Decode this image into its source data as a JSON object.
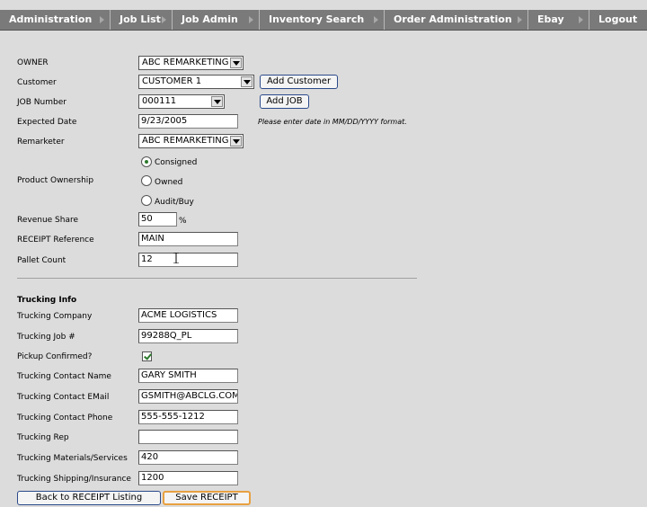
{
  "nav": {
    "items": [
      {
        "label": "Administration"
      },
      {
        "label": "Job List"
      },
      {
        "label": "Job Admin"
      },
      {
        "label": "Inventory Search"
      },
      {
        "label": "Order Administration"
      },
      {
        "label": "Ebay"
      },
      {
        "label": "Logout"
      }
    ]
  },
  "form": {
    "owner": {
      "label": "OWNER",
      "value": "ABC REMARKETING"
    },
    "customer": {
      "label": "Customer",
      "value": "CUSTOMER 1",
      "add_button": "Add Customer"
    },
    "job_number": {
      "label": "JOB Number",
      "value": "000111",
      "add_button": "Add JOB"
    },
    "expected_date": {
      "label": "Expected Date",
      "value": "9/23/2005",
      "hint": "Please enter date in MM/DD/YYYY format."
    },
    "remarketer": {
      "label": "Remarketer",
      "value": "ABC REMARKETING"
    },
    "product_ownership": {
      "label": "Product Ownership",
      "options": [
        "Consigned",
        "Owned",
        "Audit/Buy"
      ],
      "selected": "Consigned"
    },
    "revenue_share": {
      "label": "Revenue Share",
      "value": "50",
      "unit": "%"
    },
    "receipt_reference": {
      "label": "RECEIPT Reference",
      "value": "MAIN"
    },
    "pallet_count": {
      "label": "Pallet Count",
      "value": "12"
    }
  },
  "trucking": {
    "heading": "Trucking Info",
    "company": {
      "label": "Trucking Company",
      "value": "ACME LOGISTICS"
    },
    "job": {
      "label": "Trucking Job #",
      "value": "99288Q_PL"
    },
    "pickup_confirmed": {
      "label": "Pickup Confirmed?",
      "checked": true
    },
    "contact_name": {
      "label": "Trucking Contact Name",
      "value": "GARY SMITH"
    },
    "contact_email": {
      "label": "Trucking Contact EMail",
      "value": "GSMITH@ABCLG.COM"
    },
    "contact_phone": {
      "label": "Trucking Contact Phone",
      "value": "555-555-1212"
    },
    "rep": {
      "label": "Trucking Rep",
      "value": ""
    },
    "materials": {
      "label": "Trucking Materials/Services",
      "value": "420"
    },
    "shipping": {
      "label": "Trucking Shipping/Insurance",
      "value": "1200"
    }
  },
  "actions": {
    "back_label": "Back to RECEIPT Listing",
    "save_label": "Save RECEIPT"
  },
  "colors": {
    "nav_bg": "#7a7a7a",
    "page_bg": "#dcdcdc",
    "button_border": "#2b4a8a",
    "save_focus": "#e8a040",
    "check_green": "#2d7a2d"
  }
}
